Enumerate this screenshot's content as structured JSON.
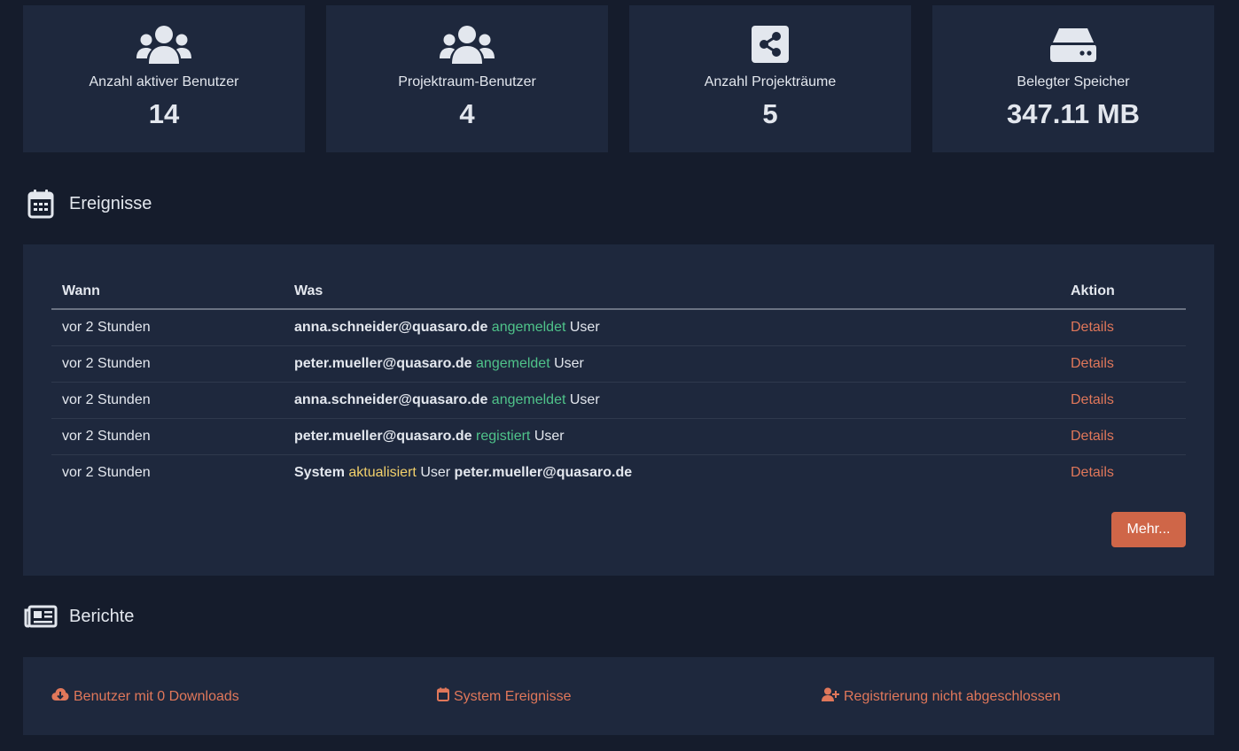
{
  "stats": [
    {
      "label": "Anzahl aktiver Benutzer",
      "value": "14",
      "icon": "users-icon"
    },
    {
      "label": "Projektraum-Benutzer",
      "value": "4",
      "icon": "users-icon"
    },
    {
      "label": "Anzahl Projekträume",
      "value": "5",
      "icon": "share-icon"
    },
    {
      "label": "Belegter Speicher",
      "value": "347.11 MB",
      "icon": "storage-icon"
    }
  ],
  "events": {
    "title": "Ereignisse",
    "headers": {
      "when": "Wann",
      "what": "Was",
      "action": "Aktion"
    },
    "rows": [
      {
        "when": "vor 2 Stunden",
        "actor": "anna.schneider@quasaro.de",
        "verb": "angemeldet",
        "object": "User",
        "target": "",
        "action": "Details"
      },
      {
        "when": "vor 2 Stunden",
        "actor": "peter.mueller@quasaro.de",
        "verb": "angemeldet",
        "object": "User",
        "target": "",
        "action": "Details"
      },
      {
        "when": "vor 2 Stunden",
        "actor": "anna.schneider@quasaro.de",
        "verb": "angemeldet",
        "object": "User",
        "target": "",
        "action": "Details"
      },
      {
        "when": "vor 2 Stunden",
        "actor": "peter.mueller@quasaro.de",
        "verb": "registiert",
        "object": "User",
        "target": "",
        "action": "Details"
      },
      {
        "when": "vor 2 Stunden",
        "actor": "System",
        "verb": "aktualisiert",
        "object": "User",
        "target": "peter.mueller@quasaro.de",
        "action": "Details"
      }
    ],
    "more_label": "Mehr..."
  },
  "reports": {
    "title": "Berichte",
    "links": [
      {
        "label": "Benutzer mit 0 Downloads",
        "icon": "cloud-download-icon"
      },
      {
        "label": "System Ereignisse",
        "icon": "calendar-icon"
      },
      {
        "label": "Registrierung nicht abgeschlossen",
        "icon": "user-plus-icon"
      }
    ]
  },
  "colors": {
    "background": "#151c2c",
    "panel": "#1e283d",
    "accent": "#cf6648",
    "link": "#e0775a",
    "success": "#4fc38a",
    "warning": "#f2d06b"
  }
}
